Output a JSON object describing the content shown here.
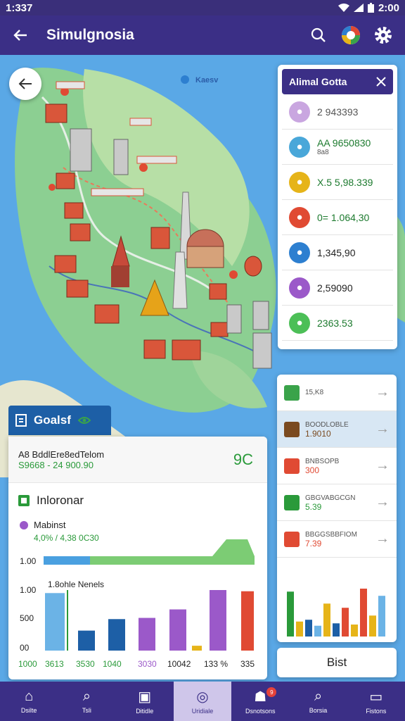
{
  "status": {
    "time": "1:337",
    "clock": "2:00"
  },
  "appbar": {
    "title": "Simulgnosia"
  },
  "map": {
    "label_top": "Kaesv"
  },
  "stats": {
    "header": "Alimal Gotta",
    "rows": [
      {
        "value": "2 943393",
        "color": "#c9a6e0",
        "icon": "tower-icon",
        "text_color": "#555"
      },
      {
        "value": "AA 9650830",
        "sub": "8a8",
        "color": "#49a7d9",
        "icon": "jar-icon",
        "text_color": "#1c7a2e"
      },
      {
        "value": "X.5 5,98.339",
        "color": "#e6b419",
        "icon": "plant-icon",
        "text_color": "#1c7a2e"
      },
      {
        "value": "0= 1.064,30",
        "color": "#e04a33",
        "icon": "document-icon",
        "text_color": "#1c7a2e"
      },
      {
        "value": "1,345,90",
        "color": "#2d7fd0",
        "icon": "phone-icon",
        "text_color": "#222"
      },
      {
        "value": "2,59090",
        "color": "#9b59c9",
        "icon": "card-icon",
        "text_color": "#222"
      },
      {
        "value": "2363.53",
        "color": "#4cbf57",
        "icon": "leaf-icon",
        "text_color": "#1c7a2e"
      }
    ]
  },
  "list": {
    "rows": [
      {
        "title": "15,K8",
        "sub": "",
        "icon": "dots-icon",
        "color": "#3aa34a"
      },
      {
        "title": "BOODLOBLE",
        "sub": "1.9010",
        "icon": "crate-icon",
        "color": "#7a4a20"
      },
      {
        "title": "BNBSOPB",
        "sub": "300",
        "icon": "cross-icon",
        "color": "#e04a33"
      },
      {
        "title": "GBGVABGCGN",
        "sub": "5.39",
        "icon": "chart-icon",
        "color": "#2a9a3a"
      },
      {
        "title": "BBGGSBBFIOM",
        "sub": "7.39",
        "icon": "people-icon",
        "color": "#e04a33"
      }
    ],
    "button": "Bist"
  },
  "goal": {
    "tab": "Goalsf"
  },
  "summary": {
    "line1": "A8 BddlEre8edTelom",
    "line2": "S9668 - 24 900.90",
    "big": "9C"
  },
  "info": {
    "title": "Inloronar"
  },
  "chart_data": {
    "type": "bar",
    "progress_label": "Mabinst",
    "progress_value": "4,0% / 4,38  0C30",
    "progress_fraction": 0.22,
    "series_title": "1.8ohle Nenels",
    "yticks": [
      "1.00",
      "1.00",
      "500",
      "00"
    ],
    "categories": [
      "1000",
      "3613",
      "3530",
      "1040",
      "3030",
      "10042",
      "133 %",
      "335"
    ],
    "values": [
      0.95,
      0.33,
      0.52,
      0.54,
      0.68,
      0.08,
      1.0,
      0.98
    ],
    "colors": [
      "#6bb3e6",
      "#1d5fa6",
      "#1d5fa6",
      "#9b59c9",
      "#9b59c9",
      "#e6b419",
      "#9b59c9",
      "#e04a33"
    ],
    "tick_colors": [
      "#2a9a3a",
      "#2a9a3a",
      "#2a9a3a",
      "#2a9a3a",
      "#9b59c9",
      "#222",
      "#222",
      "#222"
    ]
  },
  "mini_chart": {
    "values": [
      0.75,
      0.25,
      0.28,
      0.18,
      0.55,
      0.22,
      0.48,
      0.2,
      0.8,
      0.35,
      0.68
    ],
    "colors": [
      "#2a9a3a",
      "#e6b419",
      "#1d5fa6",
      "#6bb3e6",
      "#e6b419",
      "#1d5fa6",
      "#e04a33",
      "#e6b419",
      "#e04a33",
      "#e6b419",
      "#6bb3e6"
    ]
  },
  "nav": [
    {
      "label": "Dsilte",
      "icon": "home-icon"
    },
    {
      "label": "Tsli",
      "icon": "search-icon"
    },
    {
      "label": "Ditidle",
      "icon": "chat-icon"
    },
    {
      "label": "Uridiale",
      "icon": "info-icon",
      "active": true
    },
    {
      "label": "Dsnotsons",
      "icon": "group-icon",
      "badge": "9"
    },
    {
      "label": "Borsia",
      "icon": "search-icon"
    },
    {
      "label": "Fistons",
      "icon": "folder-icon"
    }
  ]
}
